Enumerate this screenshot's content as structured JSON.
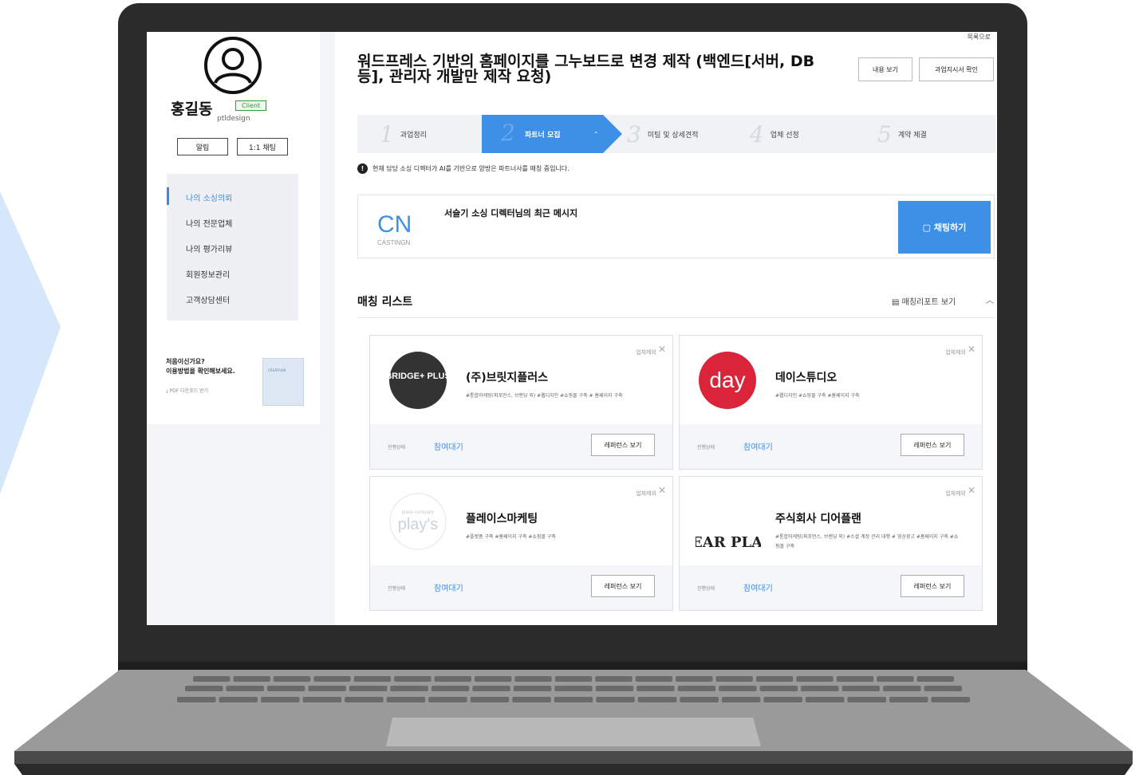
{
  "colors": {
    "accent": "#3e8fe6",
    "client_badge": "#2f9b33",
    "laptop": "#2b2b2b",
    "chevron": "#cfe0fa"
  },
  "profile": {
    "name": "홍길동",
    "badge": "Client",
    "id": "ptldesign",
    "alarm_button": "알림",
    "chat_button": "1:1 채팅",
    "avatar_icon": "user-circle-icon"
  },
  "sidebar": {
    "items": [
      {
        "label": "나의 소싱의뢰",
        "active": true
      },
      {
        "label": "나의 전문업체",
        "active": false
      },
      {
        "label": "나의 평가리뷰",
        "active": false
      },
      {
        "label": "회원정보관리",
        "active": false
      },
      {
        "label": "고객상담센터",
        "active": false
      }
    ],
    "guide": {
      "line1": "처음이신가요?",
      "line2": "이용방법을 확인해보세요.",
      "download": "PDF 다운로드 받기",
      "card_text": "CREATIVEN"
    }
  },
  "header": {
    "back": "목록으로",
    "title": "워드프레스 기반의 홈페이지를 그누보드로 변경 제작 (백엔드[서버, DB등], 관리자 개발만 제작 요청)",
    "view_content": "내용 보기",
    "view_instruction": "과업지시서 확인"
  },
  "steps": [
    {
      "num": "1",
      "label": "과업정리"
    },
    {
      "num": "2",
      "label": "파트너 모집"
    },
    {
      "num": "3",
      "label": "미팅 및 상세견적"
    },
    {
      "num": "4",
      "label": "업체 선정"
    },
    {
      "num": "5",
      "label": "계약 체결"
    }
  ],
  "active_step": 2,
  "notice": {
    "icon": "!",
    "text": "현재 담당 소싱 디렉터가 AI를 기반으로 양방은 파트너사를 매칭 중입니다."
  },
  "message": {
    "logo_top": "CN",
    "logo_bottom": "CASTINGN",
    "title": "서슬기 소싱 디렉터님의 최근 메시지",
    "chat_button": "채팅하기"
  },
  "matching": {
    "title": "매칭 리스트",
    "report": "매칭리포트 보기",
    "cards": [
      {
        "name": "(주)브릿지플러스",
        "logo": "BRIDGE+ PLUS",
        "tags": "#통합마케팅(퍼포먼스, 브랜딩 외) #웹디자인 #쇼핑몰 구축 # 홈페이지 구축",
        "exclude": "업체제외",
        "status_label": "진행상태",
        "status": "참여대기",
        "ref_button": "레퍼런스 보기"
      },
      {
        "name": "데이스튜디오",
        "logo": "day",
        "tags": "#웹디자인 #쇼핑몰 구축 #홈페이지 구축",
        "exclude": "업체제외",
        "status_label": "진행상태",
        "status": "참여대기",
        "ref_button": "레퍼런스 보기"
      },
      {
        "name": "플레이스마케팅",
        "logo": "play's",
        "logo_sub": "place company",
        "tags": "#플랫폼 구축 #홈페이지 구축 #쇼핑몰 구축",
        "exclude": "업체제외",
        "status_label": "진행상태",
        "status": "참여대기",
        "ref_button": "레퍼런스 보기"
      },
      {
        "name": "주식회사 디어플랜",
        "logo": "DEAR PLAN",
        "tags": "#통합마케팅(퍼포먼스, 브랜딩 외) #소셜 계정 관리 대행 # 영상광고 #홈페이지 구축 #쇼핑몰 구축",
        "exclude": "업체제외",
        "status_label": "진행상태",
        "status": "참여대기",
        "ref_button": "레퍼런스 보기"
      }
    ]
  }
}
